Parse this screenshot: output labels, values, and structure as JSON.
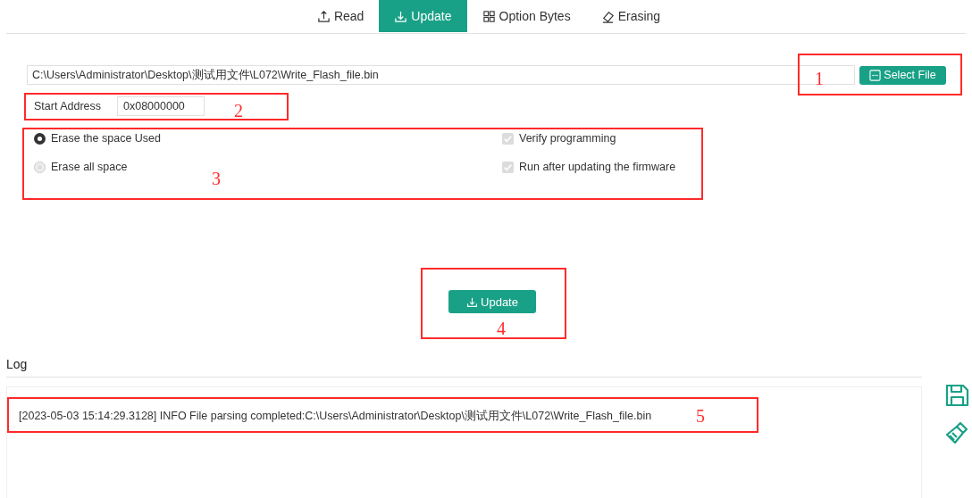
{
  "tabs": [
    {
      "label": "Read",
      "selected": false
    },
    {
      "label": "Update",
      "selected": true
    },
    {
      "label": "Option Bytes",
      "selected": false
    },
    {
      "label": "Erasing",
      "selected": false
    }
  ],
  "file_path": {
    "value": "C:\\Users\\Administrator\\Desktop\\测试用文件\\L072\\Write_Flash_file.bin"
  },
  "select_file_button": "Select File",
  "start_address": {
    "label": "Start Address",
    "value": "0x08000000"
  },
  "erase_options": [
    {
      "label": "Erase the space Used",
      "selected": true,
      "disabled": false
    },
    {
      "label": "Erase all space",
      "selected": false,
      "disabled": true
    }
  ],
  "checkboxes": [
    {
      "label": "Verify programming",
      "checked": true,
      "disabled": true
    },
    {
      "label": "Run after updating the firmware",
      "checked": true,
      "disabled": true
    }
  ],
  "update_button": "Update",
  "log": {
    "title": "Log",
    "lines": [
      "[2023-05-03 15:14:29.3128] INFO File parsing completed:C:\\Users\\Administrator\\Desktop\\测试用文件\\L072\\Write_Flash_file.bin"
    ]
  },
  "annotations": [
    {
      "label": "1"
    },
    {
      "label": "2"
    },
    {
      "label": "3"
    },
    {
      "label": "4"
    },
    {
      "label": "5"
    }
  ]
}
